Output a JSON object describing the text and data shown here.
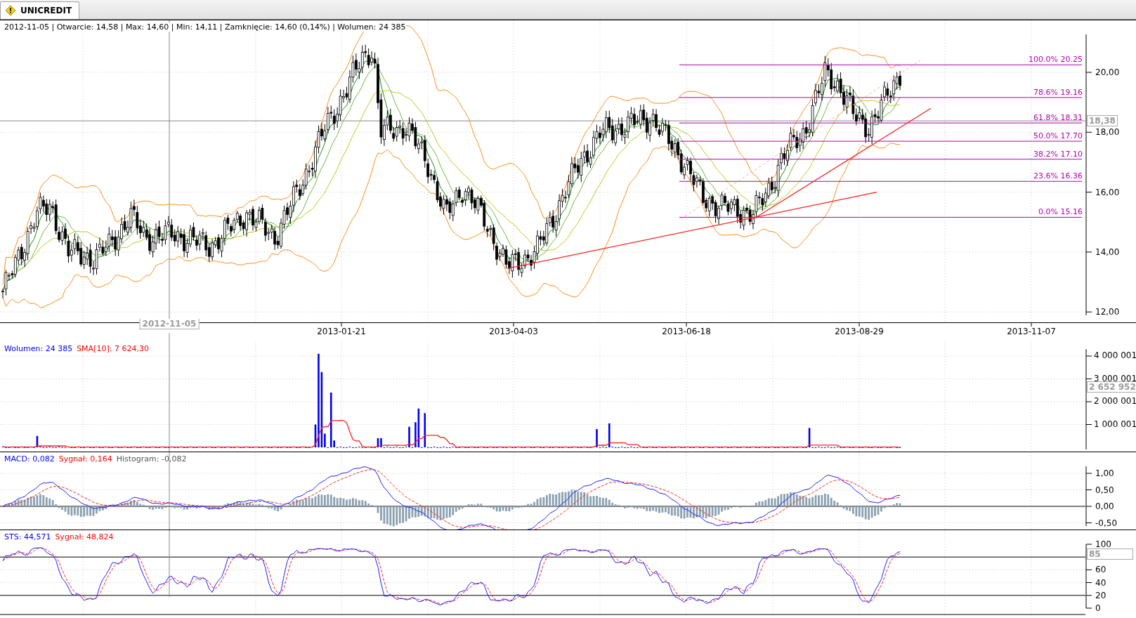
{
  "tabs": [
    {
      "label": "UNICREDIT",
      "selected": true
    }
  ],
  "price_panel": {
    "info": "2012-11-05 | Otwarcie: 14,58 | Max: 14,60 | Min: 14,11 | Zamknięcie: 14,60 (0,14%)  | Wolumen: 24 385",
    "y_ticks": [
      "20,00",
      "18,00",
      "16,00",
      "14,00",
      "12,00"
    ],
    "cursor_value": "18,38",
    "fibonacci": [
      {
        "label": "100.0% 20.25"
      },
      {
        "label": "78.6% 19.16"
      },
      {
        "label": "61.8% 18.31"
      },
      {
        "label": "50.0% 17.70"
      },
      {
        "label": "38.2% 17.10"
      },
      {
        "label": "23.6% 16.36"
      },
      {
        "label": "0.0% 15.16"
      }
    ]
  },
  "date_axis": {
    "labels": [
      "2013-01-21",
      "2013-04-03",
      "2013-06-18",
      "2013-08-29",
      "2013-11-07"
    ],
    "cursor_date": "2012-11-05"
  },
  "volume_panel": {
    "legend": [
      {
        "text": "Wolumen: 24 385",
        "color": "#0000ff"
      },
      {
        "text": "SMA[10]: 7 624,30",
        "color": "#ff0000"
      }
    ],
    "y_ticks": [
      "4 000 001",
      "3 000 001",
      "2 000 001",
      "1 000 001"
    ],
    "cursor_value": "2 652 952"
  },
  "macd_panel": {
    "legend": [
      {
        "text": "MACD: 0,082",
        "color": "#0000ff"
      },
      {
        "text": "Sygnał: 0,164",
        "color": "#ff0000"
      },
      {
        "text": "Histogram: -0,082",
        "color": "#555555"
      }
    ],
    "y_ticks": [
      "1,00",
      "0,50",
      "0,00",
      "-0,50"
    ]
  },
  "sts_panel": {
    "legend": [
      {
        "text": "STS: 44,571",
        "color": "#0000ff"
      },
      {
        "text": "Sygnał: 48,824",
        "color": "#ff0000"
      }
    ],
    "y_ticks": [
      "100",
      "60",
      "40",
      "20",
      "0"
    ],
    "cursor_value": "85"
  }
}
